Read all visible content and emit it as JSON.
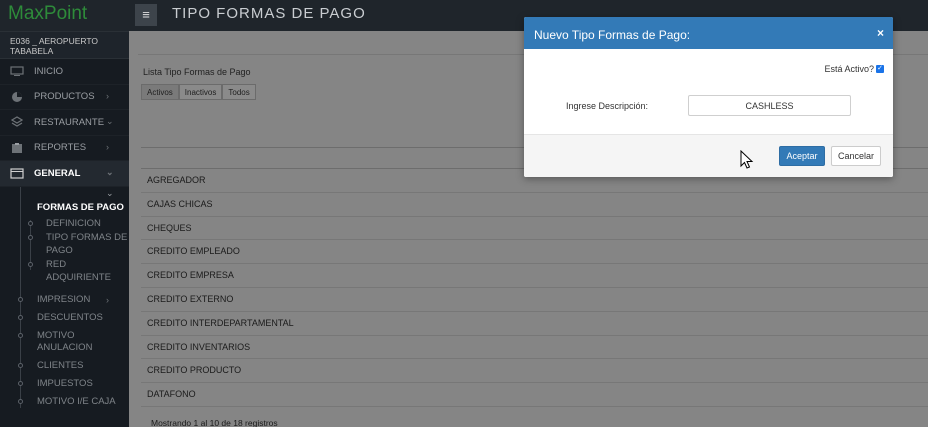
{
  "app": {
    "logo": "MaxPoint",
    "store": "E036 _ AEROPUERTO TABABELA"
  },
  "header": {
    "title": "TIPO FORMAS DE PAGO",
    "menu_icon": "hamburger-icon"
  },
  "sidebar": {
    "items": [
      {
        "label": "INICIO",
        "icon": "monitor-icon"
      },
      {
        "label": "PRODUCTOS",
        "icon": "pie-chart-icon"
      },
      {
        "label": "RESTAURANTE",
        "icon": "stack-icon"
      },
      {
        "label": "REPORTES",
        "icon": "clipboard-icon"
      },
      {
        "label": "GENERAL",
        "icon": "window-icon"
      }
    ],
    "submenu_title": "FORMAS DE PAGO",
    "submenu_items": [
      "DEFINICION",
      "TIPO FORMAS DE PAGO",
      "RED ADQUIRIENTE"
    ],
    "general_items": [
      "IMPRESION",
      "DESCUENTOS",
      "MOTIVO ANULACION",
      "CLIENTES",
      "IMPUESTOS",
      "MOTIVO I/E CAJA"
    ]
  },
  "main": {
    "list_label": "Lista Tipo Formas de Pago",
    "filters": [
      "Activos",
      "Inactivos",
      "Todos"
    ],
    "rows": [
      "AGREGADOR",
      "CAJAS CHICAS",
      "CHEQUES",
      "CREDITO EMPLEADO",
      "CREDITO EMPRESA",
      "CREDITO EXTERNO",
      "CREDITO INTERDEPARTAMENTAL",
      "CREDITO INVENTARIOS",
      "CREDITO PRODUCTO",
      "DATAFONO"
    ],
    "footer": "Mostrando 1 al 10 de 18 registros"
  },
  "modal": {
    "title": "Nuevo Tipo Formas de Pago:",
    "close": "×",
    "active_label": "Está Activo?",
    "active_checked": true,
    "desc_label": "Ingrese Descripción:",
    "desc_value": "CASHLESS",
    "ok_label": "Aceptar",
    "cancel_label": "Cancelar"
  },
  "colors": {
    "primary": "#337ab7",
    "sidebar": "#161b21",
    "logo": "#2e8b3a"
  }
}
